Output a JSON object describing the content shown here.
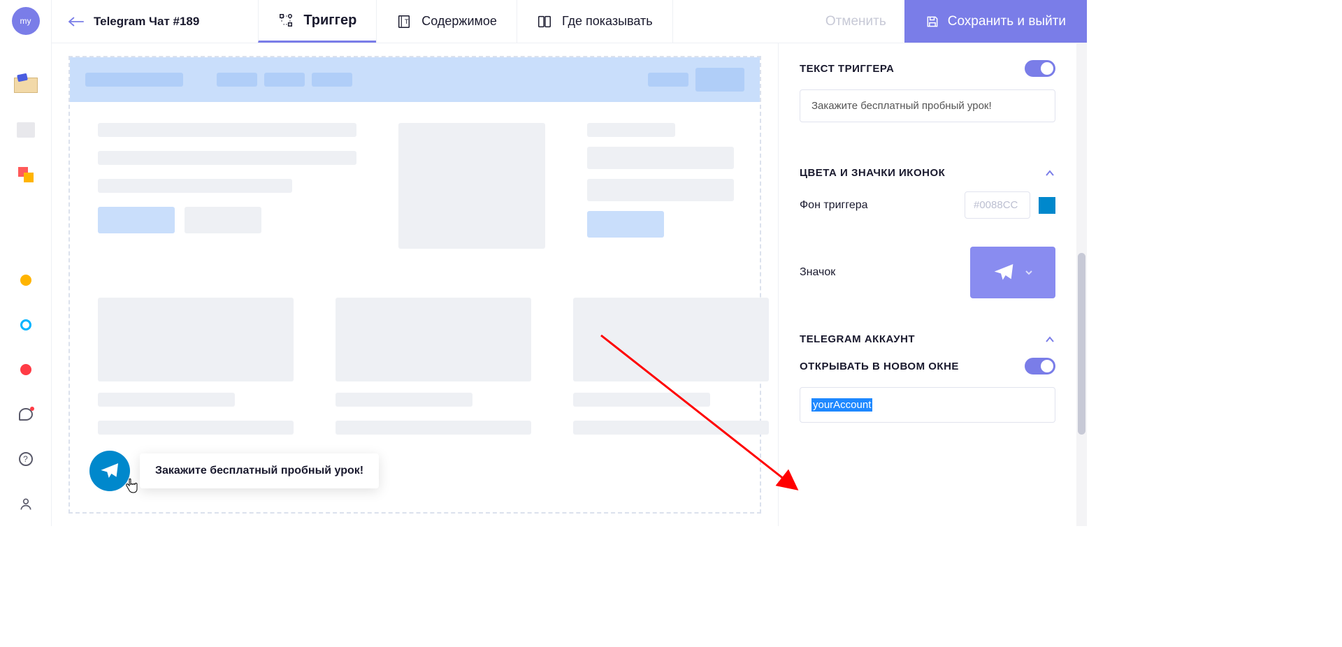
{
  "avatar_text": "my",
  "header": {
    "title": "Telegram Чат #189",
    "tabs": [
      {
        "label": "Триггер",
        "active": true
      },
      {
        "label": "Содержимое",
        "active": false
      },
      {
        "label": "Где показывать",
        "active": false
      }
    ],
    "cancel": "Отменить",
    "save": "Сохранить и выйти"
  },
  "preview": {
    "trigger_text": "Закажите бесплатный пробный урок!"
  },
  "panel": {
    "trigger_text_label": "ТЕКСТ ТРИГГЕРА",
    "trigger_text_toggle": true,
    "trigger_text_value": "Закажите бесплатный пробный урок!",
    "colors_section": "ЦВЕТА И ЗНАЧКИ ИКОНОК",
    "bg_label": "Фон триггера",
    "bg_value": "#0088CC",
    "icon_label": "Значок",
    "account_section": "TELEGRAM АККАУНТ",
    "open_new_label": "ОТКРЫВАТЬ В НОВОМ ОКНЕ",
    "open_new_toggle": true,
    "account_value": "yourAccount"
  }
}
